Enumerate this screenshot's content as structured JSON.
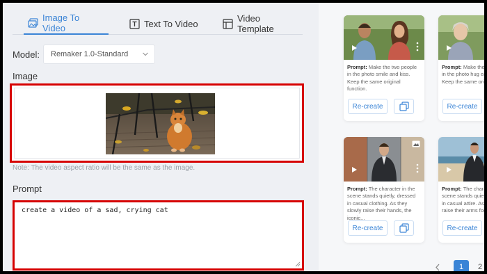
{
  "tabs": [
    {
      "label": "Image To Video",
      "icon": "image-icon",
      "active": true
    },
    {
      "label": "Text To Video",
      "icon": "text-icon",
      "active": false
    },
    {
      "label": "Video Template",
      "icon": "template-icon",
      "active": false
    }
  ],
  "model": {
    "label": "Model:",
    "value": "Remaker 1.0-Standard"
  },
  "image_section": {
    "label": "Image",
    "note": "Note: The video aspect ratio will be the same as the image."
  },
  "prompt_section": {
    "label": "Prompt",
    "value": "create a video of a sad, crying cat"
  },
  "cards": [
    {
      "prompt_label": "Prompt:",
      "prompt_text": " Make the two people in the photo smile and kiss. Keep the same original function.",
      "recreate": "Re-create"
    },
    {
      "prompt_label": "Prompt:",
      "prompt_text": " Make the two people in the photo hug each other. Keep the same original",
      "recreate": "Re-create"
    },
    {
      "prompt_label": "Prompt:",
      "prompt_text": " The character in the scene stands quietly, dressed in casual clothing. As they slowly raise their hands, the iconic...",
      "recreate": "Re-create"
    },
    {
      "prompt_label": "Prompt:",
      "prompt_text": " The character in the scene stands quietly, dressed in casual attire. As they slowly raise their arms forward, the...",
      "recreate": "Re-create"
    }
  ],
  "pagination": {
    "current": "1",
    "next": "2"
  },
  "colors": {
    "accent": "#3a84d6",
    "highlight": "#d60000",
    "panel": "#eef0f4"
  }
}
